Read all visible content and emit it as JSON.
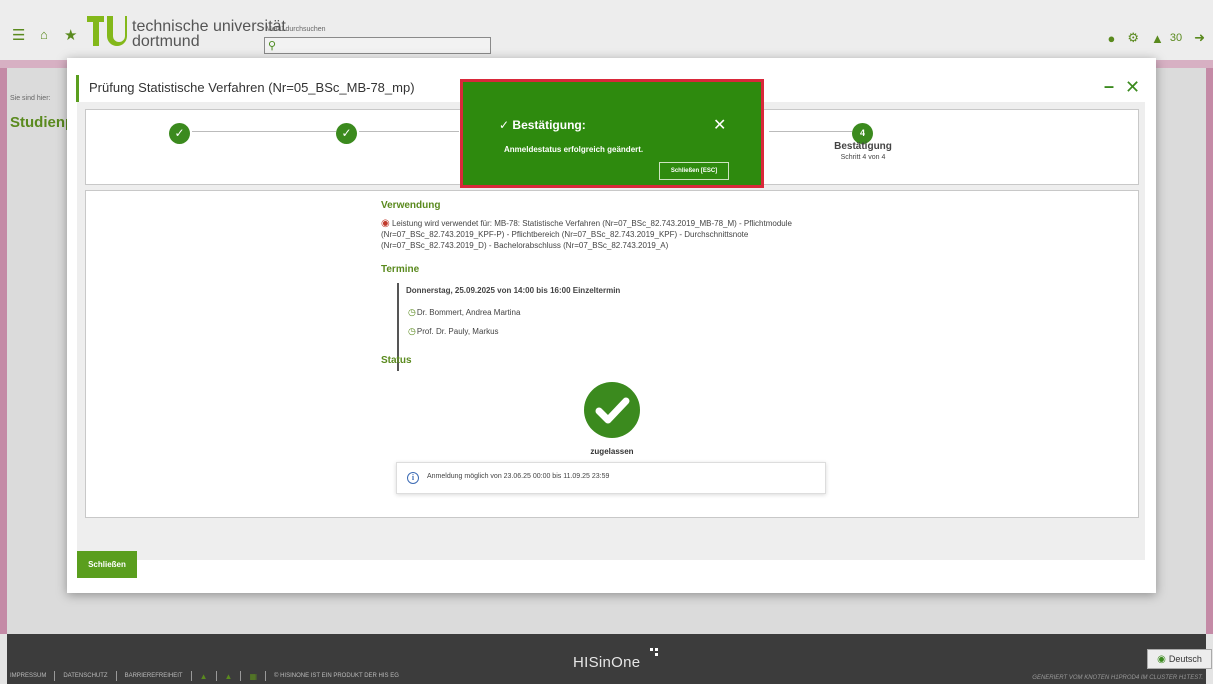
{
  "header": {
    "logo_line1": "technische universität",
    "logo_line2": "dortmund",
    "search_label": "Menü durchsuchen",
    "notification_count": "30"
  },
  "background": {
    "breadcrumb_label": "Sie sind hier:",
    "heading": "Studienp"
  },
  "modal": {
    "title": "Prüfung Statistische Verfahren (Nr=05_BSc_MB-78_mp)",
    "stepper": {
      "steps_done": 3,
      "current_step_number": "4",
      "current_step_label": "Bestätigung",
      "current_step_sub": "Schritt 4 von 4"
    },
    "verwendung": {
      "heading": "Verwendung",
      "text": "Leistung wird verwendet für: MB-78: Statistische Verfahren (Nr=07_BSc_82.743.2019_MB-78_M) - Pflichtmodule (Nr=07_BSc_82.743.2019_KPF-P) - Pflichtbereich (Nr=07_BSc_82.743.2019_KPF) - Durchschnittsnote (Nr=07_BSc_82.743.2019_D) - Bachelorabschluss (Nr=07_BSc_82.743.2019_A)"
    },
    "termine": {
      "heading": "Termine",
      "date": "Donnerstag, 25.09.2025 von 14:00 bis 16:00 Einzeltermin",
      "lecturers": [
        "Dr. Bommert, Andrea Martina",
        "Prof. Dr. Pauly, Markus"
      ]
    },
    "status": {
      "heading": "Status",
      "value": "zugelassen",
      "info": "Anmeldung möglich von 23.06.25 00:00 bis 11.09.25 23:59"
    },
    "close_label": "Schließen"
  },
  "toast": {
    "title": "Bestätigung:",
    "message": "Anmeldestatus erfolgreich geändert.",
    "button_label": "Schließen [ESC]",
    "bg_color": "#2e8a0e",
    "border_color": "#d9283a"
  },
  "footer": {
    "brand": "HISinOne",
    "links": [
      "IMPRESSUM",
      "DATENSCHUTZ",
      "BARRIEREFREIHEIT"
    ],
    "copyright": "© HISINONE IST EIN PRODUKT DER HIS EG",
    "language": "Deutsch",
    "generated": "GENERIERT VOM KNOTEN H1PROD4 IM CLUSTER H1TEST."
  }
}
